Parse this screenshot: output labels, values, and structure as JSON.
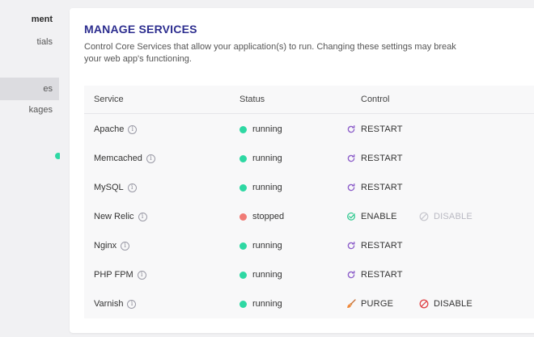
{
  "sidebar": {
    "items": [
      {
        "label": "ment",
        "active": false,
        "head": true
      },
      {
        "label": "tials",
        "active": false,
        "head": false
      },
      {
        "label": "es",
        "active": true,
        "head": false
      },
      {
        "label": "kages",
        "active": false,
        "head": false
      }
    ]
  },
  "main": {
    "title": "MANAGE SERVICES",
    "description": "Control Core Services that allow your application(s) to run. Changing these settings may break your web app's functioning."
  },
  "table": {
    "headers": {
      "service": "Service",
      "status": "Status",
      "control": "Control"
    },
    "rows": [
      {
        "name": "Apache",
        "status": "running",
        "status_color": "#2ed8a3",
        "action": "RESTART",
        "action_icon": "restart-icon"
      },
      {
        "name": "Memcached",
        "status": "running",
        "status_color": "#2ed8a3",
        "action": "RESTART",
        "action_icon": "restart-icon"
      },
      {
        "name": "MySQL",
        "status": "running",
        "status_color": "#2ed8a3",
        "action": "RESTART",
        "action_icon": "restart-icon"
      },
      {
        "name": "New Relic",
        "status": "stopped",
        "status_color": "#f07b76",
        "action": "ENABLE",
        "action_icon": "check-circle-icon",
        "action2": "DISABLE",
        "action2_icon": "disable-icon",
        "action2_disabled": true
      },
      {
        "name": "Nginx",
        "status": "running",
        "status_color": "#2ed8a3",
        "action": "RESTART",
        "action_icon": "restart-icon"
      },
      {
        "name": "PHP FPM",
        "status": "running",
        "status_color": "#2ed8a3",
        "action": "RESTART",
        "action_icon": "restart-icon"
      },
      {
        "name": "Varnish",
        "status": "running",
        "status_color": "#2ed8a3",
        "action": "PURGE",
        "action_icon": "broom-icon",
        "action2": "DISABLE",
        "action2_icon": "disable-icon",
        "action2_disabled": false
      }
    ]
  },
  "colors": {
    "accent": "#2d2e8f",
    "running": "#2ed8a3",
    "stopped": "#f07b76",
    "icon_purple": "#8b5cc9",
    "disable_red": "#e0464a"
  }
}
